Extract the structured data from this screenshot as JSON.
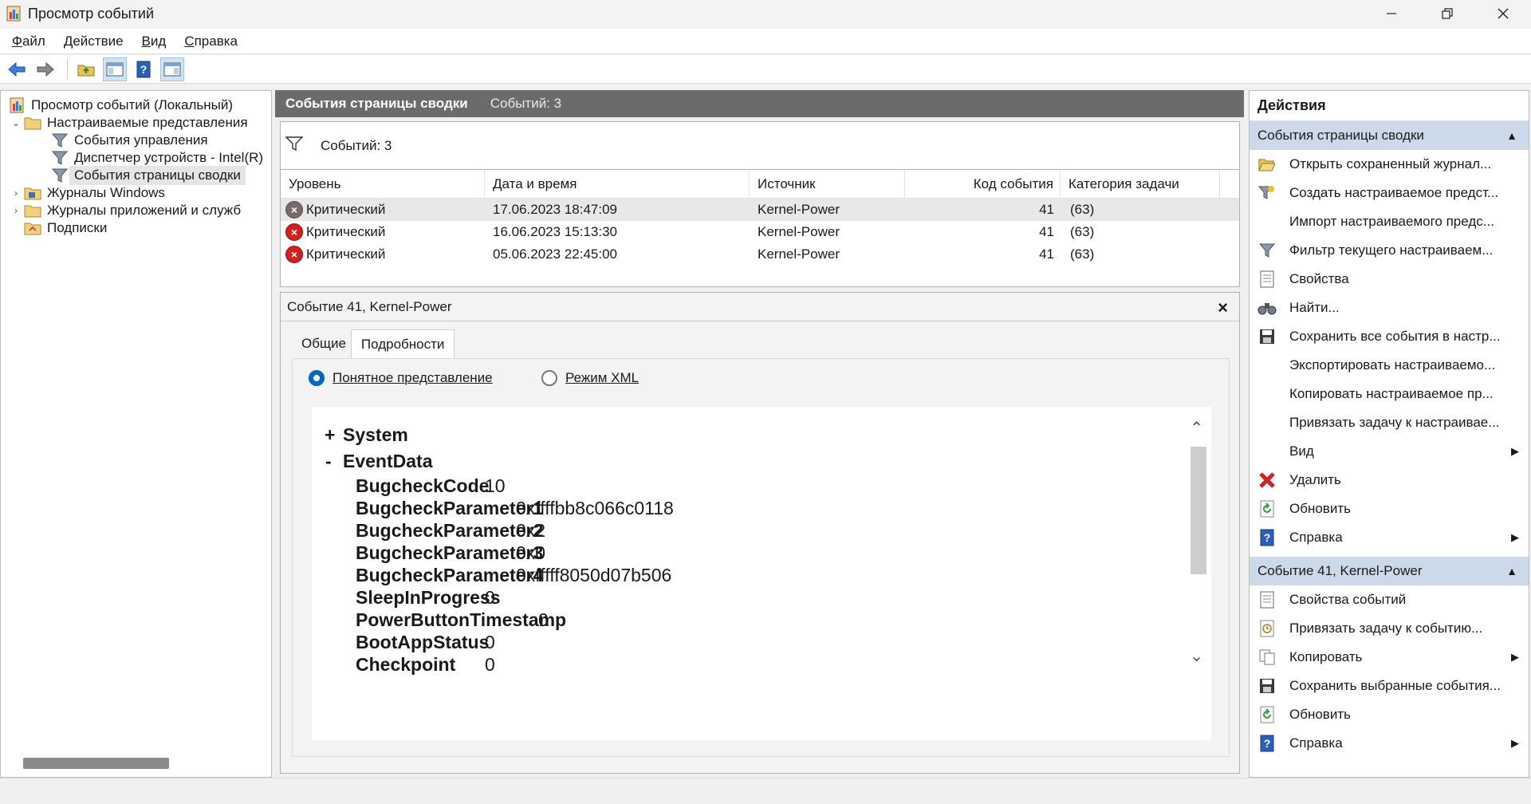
{
  "window": {
    "title": "Просмотр событий"
  },
  "menu": [
    {
      "pre": "",
      "ul": "Ф",
      "post": "айл"
    },
    {
      "pre": "",
      "ul": "Д",
      "post": "ействие"
    },
    {
      "pre": "",
      "ul": "В",
      "post": "ид"
    },
    {
      "pre": "",
      "ul": "С",
      "post": "правка"
    }
  ],
  "tree": {
    "root": "Просмотр событий (Локальный)",
    "custom_views": "Настраиваемые представления",
    "admin_events": "События управления",
    "device_manager": "Диспетчер устройств - Intel(R)",
    "summary_events": "События страницы сводки",
    "windows_logs": "Журналы Windows",
    "app_logs": "Журналы приложений и служб",
    "subscriptions": "Подписки"
  },
  "center": {
    "header_title": "События страницы сводки",
    "header_count": "Событий: 3",
    "filter_count": "Событий: 3",
    "columns": {
      "level": "Уровень",
      "date": "Дата и время",
      "source": "Источник",
      "code": "Код события",
      "category": "Категория задачи"
    },
    "rows": [
      {
        "level": "Критический",
        "date": "17.06.2023 18:47:09",
        "source": "Kernel-Power",
        "code": "41",
        "category": "(63)"
      },
      {
        "level": "Критический",
        "date": "16.06.2023 15:13:30",
        "source": "Kernel-Power",
        "code": "41",
        "category": "(63)"
      },
      {
        "level": "Критический",
        "date": "05.06.2023 22:45:00",
        "source": "Kernel-Power",
        "code": "41",
        "category": "(63)"
      }
    ]
  },
  "detail": {
    "title": "Событие 41, Kernel-Power",
    "tab_general": "Общие",
    "tab_details": "Подробности",
    "radio_friendly": "Понятное представление",
    "radio_xml": "Режим XML",
    "system": "System",
    "eventdata": "EventData",
    "fields": [
      {
        "k": "BugcheckCode",
        "v": "10"
      },
      {
        "k": "BugcheckParameter1",
        "v": "0xffffbb8c066c0118"
      },
      {
        "k": "BugcheckParameter2",
        "v": "0x2"
      },
      {
        "k": "BugcheckParameter3",
        "v": "0x0"
      },
      {
        "k": "BugcheckParameter4",
        "v": "0xfffff8050d07b506"
      },
      {
        "k": "SleepInProgress",
        "v": "0"
      },
      {
        "k": "PowerButtonTimestamp",
        "v": "0"
      },
      {
        "k": "BootAppStatus",
        "v": "0"
      },
      {
        "k": "Checkpoint",
        "v": "0"
      }
    ]
  },
  "actions": {
    "title": "Действия",
    "group1": "События страницы сводки",
    "g1": [
      "Открыть сохраненный журнал...",
      "Создать настраиваемое предст...",
      "Импорт настраиваемого предс...",
      "Фильтр текущего настраиваем...",
      "Свойства",
      "Найти...",
      "Сохранить все события в настр...",
      "Экспортировать настраиваемо...",
      "Копировать настраиваемое пр...",
      "Привязать задачу к настраивае...",
      "Вид",
      "Удалить",
      "Обновить",
      "Справка"
    ],
    "group2": "Событие 41, Kernel-Power",
    "g2": [
      "Свойства событий",
      "Привязать задачу к событию...",
      "Копировать",
      "Сохранить выбранные события...",
      "Обновить",
      "Справка"
    ]
  }
}
